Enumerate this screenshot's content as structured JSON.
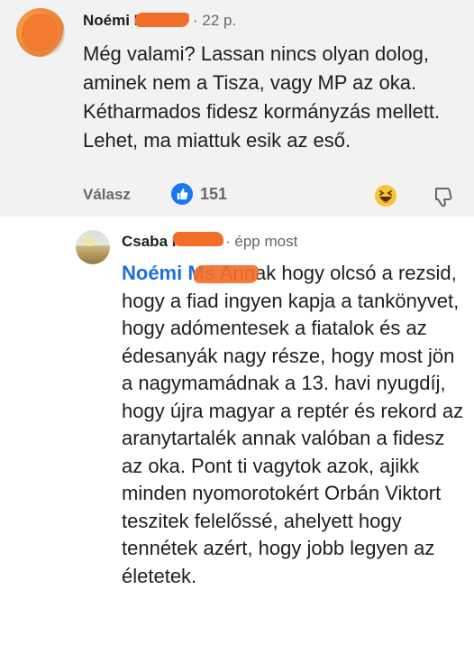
{
  "comment": {
    "author": "Noémi M",
    "time": "· 22 p.",
    "text": "Még valami? Lassan nincs olyan dolog, aminek nem  a Tisza, vagy MP az oka. Kétharmados fidesz kormányzás mellett.  Lehet, ma miattuk esik az eső.",
    "reply_label": "Válasz",
    "like_count": "151",
    "colors": {
      "like": "#1877f2",
      "redact": "#f26f2a"
    }
  },
  "reply": {
    "author": "Csaba F",
    "time": "· épp most",
    "mention": "Noémi M",
    "mention_suffix": "s",
    "text": " Annak hogy olcsó a rezsid, hogy a fiad ingyen kapja a tankönyvet, hogy adómentesek a fiatalok és az édesanyák nagy része, hogy most jön a nagymamádnak a 13. havi nyugdíj, hogy újra magyar a reptér és rekord az aranytartalék annak valóban a fidesz az oka. Pont ti vagytok azok, ajikk minden nyomorotokért Orbán Viktort teszitek felelőssé, ahelyett hogy tennétek azért, hogy jobb legyen az életetek.",
    "colors": {
      "mention": "#216fdb"
    }
  }
}
